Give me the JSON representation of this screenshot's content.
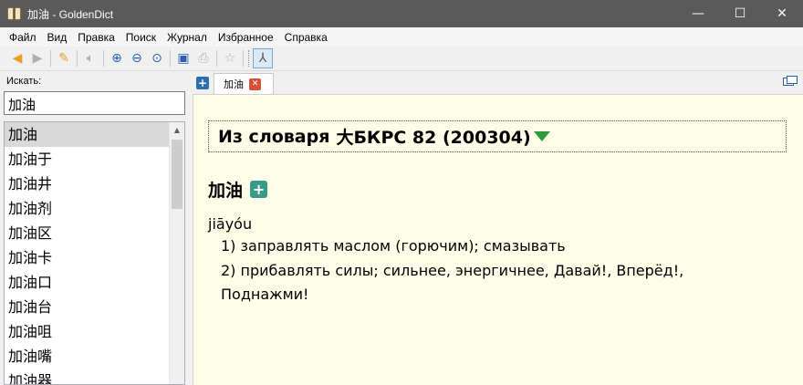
{
  "window": {
    "title": "加油 - GoldenDict",
    "controls": {
      "minimize": "—",
      "maximize": "☐",
      "close": "✕"
    }
  },
  "menu": [
    "Файл",
    "Вид",
    "Правка",
    "Поиск",
    "Журнал",
    "Избранное",
    "Справка"
  ],
  "toolbar": {
    "icons": [
      "back-icon",
      "forward-icon",
      "scan-popup-icon",
      "pronounce-icon",
      "zoom-in-icon",
      "zoom-out-icon",
      "zoom-reset-icon",
      "save-icon",
      "print-icon",
      "favorites-star-icon",
      "chinese-conversion-icon"
    ]
  },
  "search": {
    "label": "Искать:",
    "value": "加油"
  },
  "wordlist": [
    "加油",
    "加油于",
    "加油井",
    "加油剂",
    "加油区",
    "加油卡",
    "加油口",
    "加油台",
    "加油咀",
    "加油嘴",
    "加油器"
  ],
  "tabs": [
    {
      "label": "加油",
      "close": "✕"
    }
  ],
  "article": {
    "dict_prefix": "Из словаря",
    "dict_name": "大БКРС 82 (200304)",
    "headword": "加油",
    "add_fav": "+",
    "pinyin": "jiāyóu",
    "definitions": [
      "1) заправлять маслом (горючим); смазывать",
      "2) прибавлять силы; сильнее, энергичнее, Давай!, Вперёд!, Поднажми!"
    ]
  },
  "colors": {
    "titlebar": "#5a5a5a",
    "article_bg": "#fefde8",
    "selected_row": "#d9d9d9",
    "expand_arrow": "#2e9a3a",
    "tab_close": "#d8503a"
  }
}
